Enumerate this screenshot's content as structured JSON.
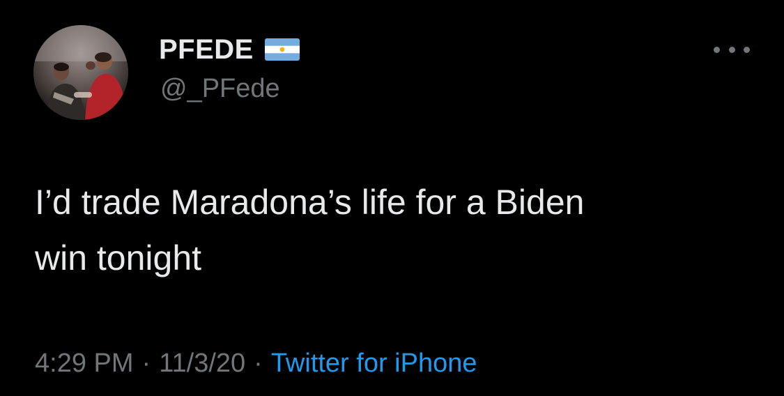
{
  "tweet": {
    "author": {
      "display_name": "PFEDE",
      "handle": "@_PFede",
      "flag_icon": "argentina-flag-icon"
    },
    "more_icon": "more-horizontal-icon",
    "text": "I’d trade Maradona’s life for a Biden\nwin tonight",
    "time": "4:29 PM",
    "separator": "·",
    "date": "11/3/20",
    "source": "Twitter for iPhone"
  },
  "colors": {
    "background": "#000000",
    "primary_text": "#e7e9ea",
    "secondary_text": "#71767b",
    "link": "#1d9bf0",
    "flag_blue": "#74acdf",
    "flag_white": "#ffffff",
    "flag_sun": "#f6b40e"
  }
}
